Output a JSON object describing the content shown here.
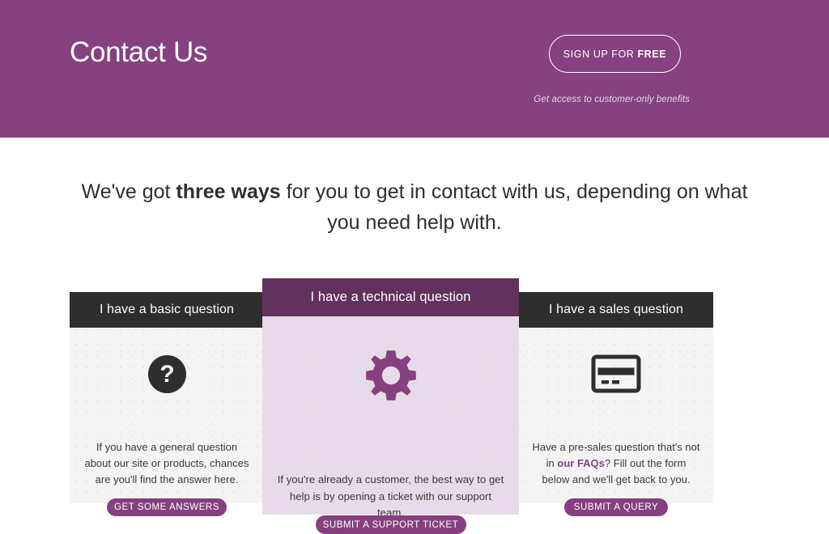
{
  "header": {
    "title": "Contact Us",
    "signup_button": {
      "text_normal": "SIGN UP FOR",
      "text_bold": "FREE",
      "full": "SIGN UP FOR FREE"
    },
    "tagline": "Get access to customer-only benefits",
    "background_color": "#854180"
  },
  "intro": {
    "prefix": "We've got ",
    "highlight": "three ways",
    "suffix": " for you to get in contact with us, depending on what you need help with."
  },
  "cards": [
    {
      "id": "basic",
      "featured": false,
      "heading": "I have a basic question",
      "icon": "question-mark-icon",
      "body_line1": "If you have a general question",
      "body_line2": "about our site or products, chances",
      "body_line3": "are you'll find the answer here.",
      "button_label": "GET SOME ANSWERS",
      "header_color": "#2e2e2e",
      "body_color": "#f4f4f4",
      "button_color": "#86407f"
    },
    {
      "id": "technical",
      "featured": true,
      "heading": "I have a technical question",
      "icon": "gear-icon",
      "body_line1": "If you're already a customer, the best way to get",
      "body_line2": "help is by opening a ticket with our support team.",
      "button_label": "SUBMIT A SUPPORT TICKET",
      "header_color": "#63315d",
      "body_color": "#e8dbe9",
      "button_color": "#86407f"
    },
    {
      "id": "sales",
      "featured": false,
      "heading": "I have a sales question",
      "icon": "credit-card-icon",
      "body_part1": "Have a pre-sales question that's not in ",
      "body_link": "our FAQs",
      "body_part2": "? Fill out the form below and we'll get back to you.",
      "button_label": "SUBMIT A QUERY",
      "header_color": "#2e2e2e",
      "body_color": "#f4f4f4",
      "button_color": "#86407f",
      "link_color": "#86407f"
    }
  ]
}
